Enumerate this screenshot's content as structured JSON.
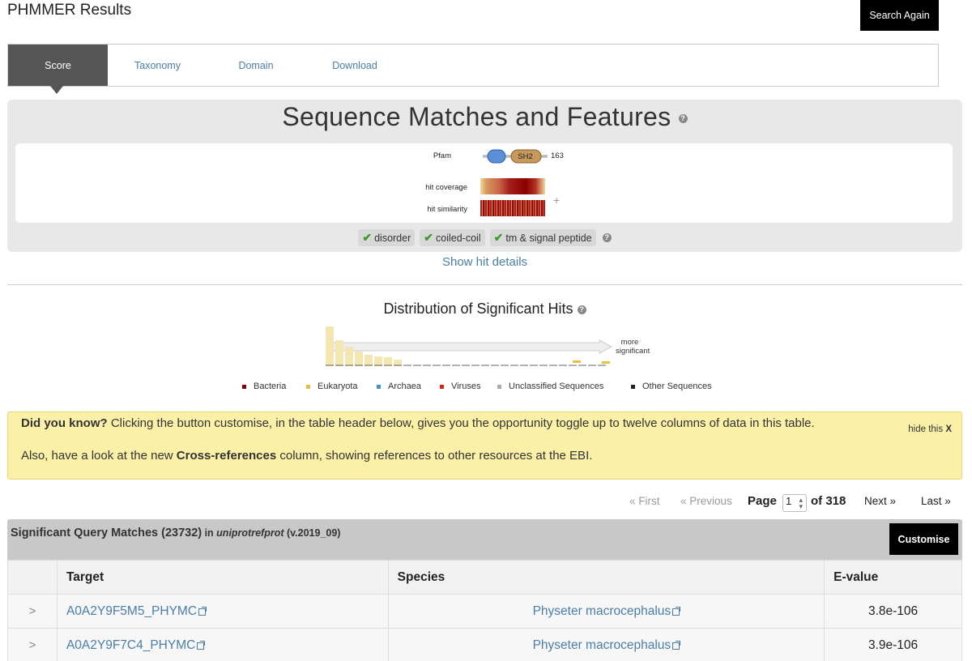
{
  "header": {
    "title": "PHMMER Results",
    "search_again": "Search Again"
  },
  "tabs": [
    {
      "label": "Score",
      "active": true
    },
    {
      "label": "Taxonomy",
      "active": false
    },
    {
      "label": "Domain",
      "active": false
    },
    {
      "label": "Download",
      "active": false
    }
  ],
  "sequence_panel": {
    "title": "Sequence Matches and Features",
    "pfam_label": "Pfam",
    "domain_label": "SH2",
    "length": "163",
    "hit_coverage_label": "hit coverage",
    "hit_similarity_label": "hit similarity",
    "expand_symbol": "+",
    "features": [
      "disorder",
      "coiled-coil",
      "tm & signal peptide"
    ],
    "show_hit_details": "Show hit details"
  },
  "distribution": {
    "title": "Distribution of Significant Hits",
    "arrow_label_line1": "more",
    "arrow_label_line2": "significant",
    "legend": [
      {
        "label": "Bacteria",
        "color": "#8b0000"
      },
      {
        "label": "Eukaryota",
        "color": "#e8c040"
      },
      {
        "label": "Archaea",
        "color": "#4a90c0"
      },
      {
        "label": "Viruses",
        "color": "#e02020"
      },
      {
        "label": "Unclassified Sequences",
        "color": "#aaaaaa"
      },
      {
        "label": "Other Sequences",
        "color": "#222222"
      }
    ]
  },
  "did_you_know": {
    "heading": "Did you know?",
    "text1": " Clicking the button customise, in the table header below, gives you the opportunity toggle up to twelve columns of data in this table.",
    "text2_prefix": "Also, have a look at the new ",
    "text2_bold": "Cross-references",
    "text2_suffix": " column, showing references to other resources at the EBI.",
    "hide_label": "hide this",
    "hide_x": "X"
  },
  "pager": {
    "first": "« First",
    "previous": "« Previous",
    "page_label": "Page",
    "current_page": "1",
    "of_label": "of 318",
    "next": "Next »",
    "last": "Last »"
  },
  "results": {
    "title_bold": "Significant Query Matches (23732)",
    "in_label": " in ",
    "database": "uniprotrefprot",
    "version": " (v.2019_09)",
    "customise": "Customise",
    "columns": [
      "",
      "Target",
      "Species",
      "E-value"
    ],
    "rows": [
      {
        "expand": ">",
        "target": "A0A2Y9F5M5_PHYMC",
        "species": "Physeter macrocephalus",
        "evalue": "3.8e-106"
      },
      {
        "expand": ">",
        "target": "A0A2Y9F7C4_PHYMC",
        "species": "Physeter macrocephalus",
        "evalue": "3.9e-106"
      }
    ]
  }
}
